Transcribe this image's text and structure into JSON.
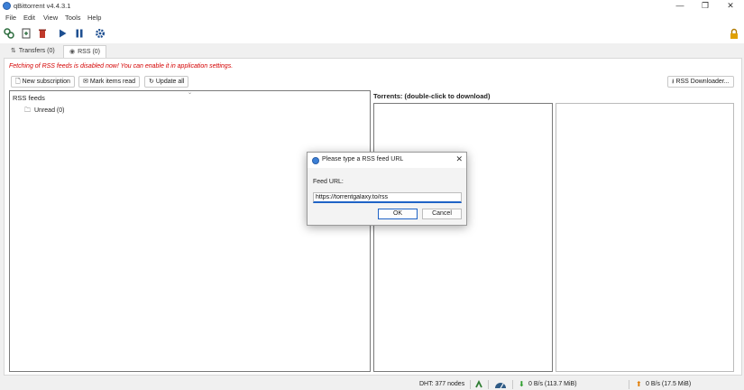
{
  "window": {
    "title": "qBittorrent v4.4.3.1",
    "minimize": "—",
    "maximize": "❐",
    "close": "✕"
  },
  "menu": [
    "File",
    "Edit",
    "View",
    "Tools",
    "Help"
  ],
  "tabs": [
    {
      "label": "Transfers (0)"
    },
    {
      "label": "RSS (0)"
    }
  ],
  "rss": {
    "warning": "Fetching of RSS feeds is disabled now! You can enable it in application settings.",
    "new_subscription": "New subscription",
    "mark_items_read": "Mark items read",
    "update_all": "Update all",
    "rss_downloader": "RSS Downloader...",
    "feeds_header": "RSS feeds",
    "unread_item": "Unread  (0)",
    "torrents_header": "Torrents: (double-click to download)"
  },
  "dialog": {
    "title": "Please type a RSS feed URL",
    "feed_label": "Feed URL:",
    "feed_value": "https://torrentgalaxy.to/rss",
    "ok": "OK",
    "cancel": "Cancel"
  },
  "status": {
    "dht": "DHT: 377 nodes",
    "download": "0 B/s (113.7 MiB)",
    "upload": "0 B/s (17.5 MiB)"
  },
  "colors": {
    "accent": "#1f63c6",
    "warning": "#d40000",
    "download_arrow": "#2e9e2e",
    "upload_arrow": "#e07b00",
    "lock": "#e0a000"
  }
}
